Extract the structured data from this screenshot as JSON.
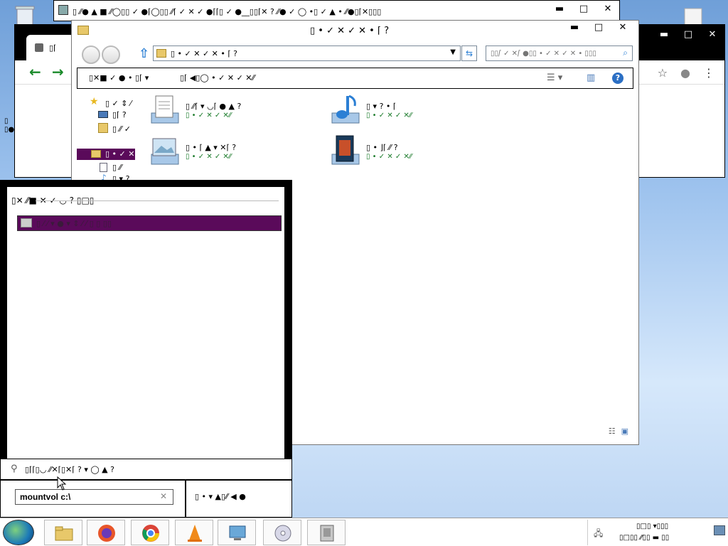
{
  "colors": {
    "selection": "#5a0a5a",
    "green_text": "#1a7a2a",
    "accent_blue": "#2b7fd4"
  },
  "back_window": {
    "title": "▯ ⁄⁄● ▲ ■ ⁄⁄◯▯▯ ✓ ●⌈◯▯▯ ⁄⁄⌈ ✓ ✕ ✓ ●⌈⌈▯ ✓ ●__▯▯⌈✕ ? ⁄⁄● ✓ ◯ •▯ ✓ ▲ • ⁄⁄●▯⌈✕▯▯▯",
    "minimize": "▬",
    "maximize": "□",
    "close": "✕"
  },
  "chrome": {
    "tab_title": "▯⌈",
    "back": "←",
    "forward": "→",
    "bookmark": "☆",
    "account": "●",
    "menu": "⋮",
    "minimize": "▬",
    "maximize": "□",
    "close": "✕"
  },
  "explorer": {
    "title": "▯ • ✓ ✕ ✓ ✕ • ⌈ ?",
    "minimize": "▬",
    "maximize": "□",
    "close": "✕",
    "address": "▯ • ✓ ✕ ✓ ✕ • ⌈ ?",
    "address_arrow": "▸",
    "search_placeholder": "▯▯⌈ ✓ ✕⌈ ●▯▯ • ✓ ✕ ✓ ✕ • ▯▯▯",
    "toolbar": {
      "organize": "▯✕■ ✓ ● • ▯⌈ ▾",
      "new_folder": "▯⌈ ◀▯◯ • ✓ ✕ ✓ ✕⁄⁄"
    },
    "nav": {
      "favorites": "▯ ✓ ⇕ ⁄",
      "desktop": "▯⌈ ?",
      "downloads": "▯ ⁄⁄ ✓",
      "libraries": "▯ • ✓ ✕",
      "documents": "▯ ⁄⁄",
      "music": "▯ ▾ ?"
    },
    "libraries": [
      {
        "name": "▯ ⁄⁄⌈ ▾ ◡⌈ ● ▲ ?",
        "sub": "▯ • ✓ ✕ ✓ ✕⁄⁄",
        "icon": "documents-icon"
      },
      {
        "name": "▯ ▾ ? • ⌈",
        "sub": "▯ • ✓ ✕ ✓ ✕⁄⁄",
        "icon": "music-icon"
      },
      {
        "name": "▯ • ⌈ ▲ ▾ ✕⌈ ?",
        "sub": "▯ • ✓ ✕ ✓ ✕⁄⁄",
        "icon": "pictures-icon"
      },
      {
        "name": "▯ • ⌋⌈ ⁄⁄ ?",
        "sub": "▯ • ✓ ✕ ✓ ✕⁄⁄",
        "icon": "videos-icon"
      }
    ]
  },
  "dialog": {
    "header": "▯✕ ⁄⁄■ ✕ ✓ ◡ ? ▯□▯",
    "row_label": "▯ ⁄ ⁄ ▾ ● ▾ ⇕ ⁄ ⁄ ▯ ▯ ▯▯",
    "search_label": "▯⌈⌈▯◡ ⁄⁄✕⌈▯✕⌈ ? ▾ ◯ ▲ ?",
    "input_value": "mountvol c:\\",
    "clear": "✕",
    "action_label": "▯ • ▾ ▲▯⁄⁄ ◀ ●"
  },
  "taskbar": {
    "apps": [
      "file-explorer",
      "firefox",
      "chrome",
      "vlc",
      "control-panel",
      "disc-app",
      "archive-app"
    ],
    "tray_line1": "▯□▯ ▾▯▯▯",
    "tray_line2": "▯□▯▯ ⁄⁄▯▯ ▬ ▯▯"
  }
}
